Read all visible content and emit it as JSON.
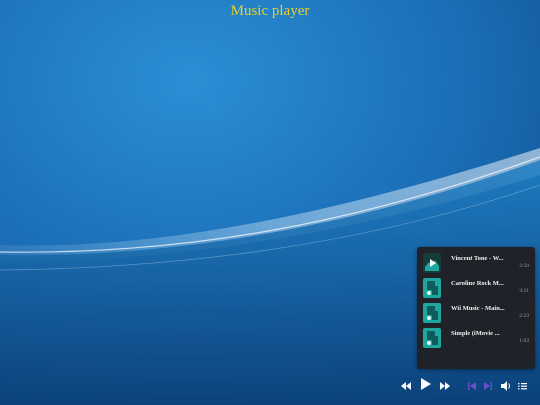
{
  "app": {
    "title": "Music player"
  },
  "playlist": {
    "tracks": [
      {
        "name": "Vincent Tone - W...",
        "duration": "2:34",
        "playing": true
      },
      {
        "name": "Caroline Rock M...",
        "duration": "3:21",
        "playing": false
      },
      {
        "name": "Wii Music - Main...",
        "duration": "2:23",
        "playing": false
      },
      {
        "name": "Simple (iMovie ...",
        "duration": "1:03",
        "playing": false
      }
    ]
  },
  "controls": {
    "icons": [
      "rewind-icon",
      "play-icon",
      "fast-forward-icon",
      "previous-icon",
      "next-icon",
      "volume-icon",
      "playlist-icon"
    ],
    "accent": "#6a4fd0"
  },
  "colors": {
    "title": "#e8cf2a",
    "panel": "#1f2329",
    "thumb": "#1ea7a0",
    "wallpaper": "#1a6fb8"
  }
}
